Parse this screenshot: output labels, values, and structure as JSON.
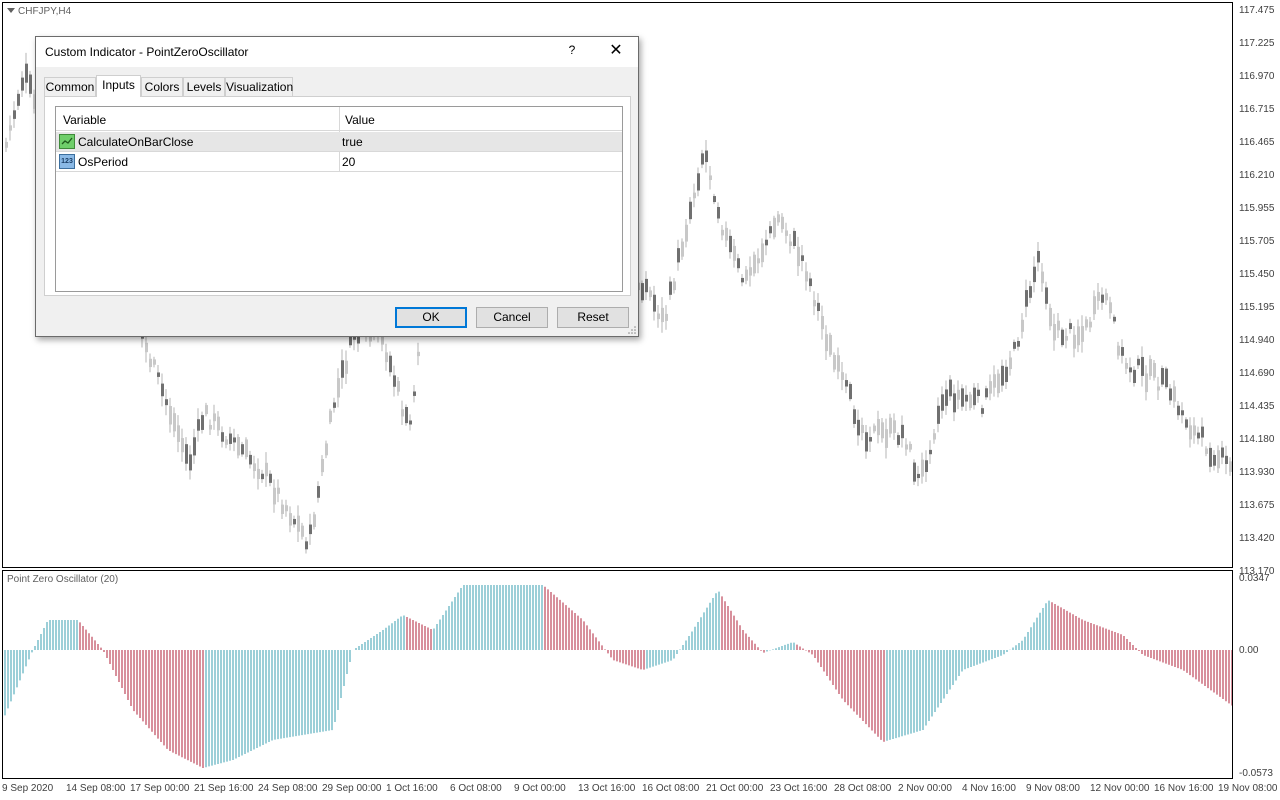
{
  "chart": {
    "symbol_label": "CHFJPY,H4",
    "indicator_label": "Point Zero Oscillator (20)",
    "price_axis": [
      "117.475",
      "117.225",
      "116.970",
      "116.715",
      "116.465",
      "116.210",
      "115.955",
      "115.705",
      "115.450",
      "115.195",
      "114.940",
      "114.690",
      "114.435",
      "114.180",
      "113.930",
      "113.675",
      "113.420",
      "113.170"
    ],
    "osc_axis": [
      "0.0347",
      "0.00",
      "-0.0573"
    ],
    "time_axis": [
      "9 Sep 2020",
      "14 Sep 08:00",
      "17 Sep 00:00",
      "21 Sep 16:00",
      "24 Sep 08:00",
      "29 Sep 00:00",
      "1 Oct 16:00",
      "6 Oct 08:00",
      "9 Oct 00:00",
      "13 Oct 16:00",
      "16 Oct 08:00",
      "21 Oct 00:00",
      "23 Oct 16:00",
      "28 Oct 08:00",
      "2 Nov 00:00",
      "4 Nov 16:00",
      "9 Nov 08:00",
      "12 Nov 00:00",
      "16 Nov 16:00",
      "19 Nov 08:00"
    ],
    "colors": {
      "bull": "#3a9fb0",
      "bear": "#b0203a",
      "candle_up": "#c8c8c8",
      "candle_down": "#707070"
    }
  },
  "dialog": {
    "title": "Custom Indicator - PointZeroOscillator",
    "help": "?",
    "close": "✕",
    "tabs": [
      "Common",
      "Inputs",
      "Colors",
      "Levels",
      "Visualization"
    ],
    "active_tab": "Inputs",
    "columns": {
      "variable": "Variable",
      "value": "Value"
    },
    "rows": [
      {
        "icon": "bool-param-icon",
        "name": "CalculateOnBarClose",
        "value": "true"
      },
      {
        "icon": "int-param-icon",
        "name": "OsPeriod",
        "value": "20",
        "icon_text": "123"
      }
    ],
    "buttons": {
      "ok": "OK",
      "cancel": "Cancel",
      "reset": "Reset"
    }
  }
}
